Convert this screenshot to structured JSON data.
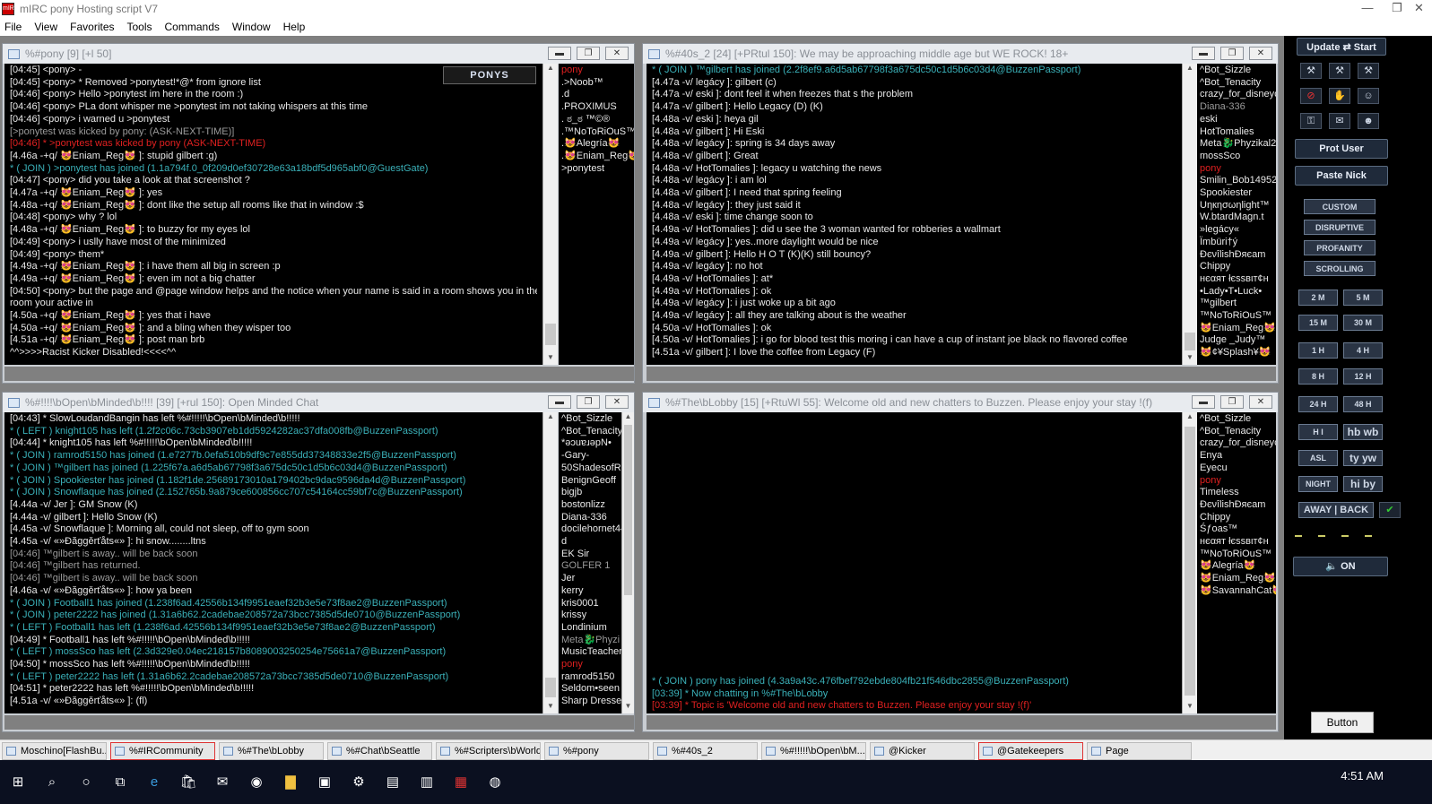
{
  "app": {
    "title": "mIRC pony Hosting script V7"
  },
  "window_controls": {
    "minimize": "—",
    "maximize": "❐",
    "close": "✕"
  },
  "menu": [
    "File",
    "View",
    "Favorites",
    "Tools",
    "Commands",
    "Window",
    "Help"
  ],
  "pony_window": {
    "title": "%#pony [9] [+l 50]",
    "ponys_button": "PONYS",
    "lines": [
      {
        "t": "[04:45] <pony> -",
        "c": ""
      },
      {
        "t": "[04:45] <pony> * Removed >ponytest!*@* from ignore list",
        "c": ""
      },
      {
        "t": "[04:46] <pony> Hello >ponytest im here in the room :)",
        "c": ""
      },
      {
        "t": "[04:46] <pony> PLa dont whisper me >ponytest im not taking whispers at this time",
        "c": ""
      },
      {
        "t": "[04:46] <pony> i warned u >ponytest",
        "c": ""
      },
      {
        "t": "[>ponytest was kicked by pony: (ASK-NEXT-TIME)]",
        "c": "c-gray"
      },
      {
        "t": "[04:46] * >ponytest was kicked by pony (ASK-NEXT-TIME)",
        "c": "c-red"
      },
      {
        "t": "[4.46a -+q/ 😻Eniam_Reg😻 ]: stupid gilbert :g)",
        "c": ""
      },
      {
        "t": "* ( JOIN ) >ponytest has joined (1.1a794f.0_0f209d0ef30728e63a18bdf5d965abf0@GuestGate)",
        "c": "c-cyan"
      },
      {
        "t": "[04:47] <pony> did you take a look at that screenshot ?",
        "c": ""
      },
      {
        "t": "[4.47a -+q/ 😻Eniam_Reg😻 ]: yes",
        "c": ""
      },
      {
        "t": "[4.48a -+q/ 😻Eniam_Reg😻 ]: dont like the setup all rooms like that in window :$",
        "c": ""
      },
      {
        "t": "[04:48] <pony> why ? lol",
        "c": ""
      },
      {
        "t": "[4.48a -+q/ 😻Eniam_Reg😻 ]: to buzzy for my eyes lol",
        "c": ""
      },
      {
        "t": "[04:49] <pony> i uslly have most of the minimized",
        "c": ""
      },
      {
        "t": "[04:49] <pony> them*",
        "c": ""
      },
      {
        "t": "[4.49a -+q/ 😻Eniam_Reg😻 ]: i have them all big in screen :p",
        "c": ""
      },
      {
        "t": "[4.49a -+q/ 😻Eniam_Reg😻 ]: even im not a big chatter",
        "c": ""
      },
      {
        "t": "[04:50] <pony> but the page and @page window helps and the notice when your name is said in a room shows you in the",
        "c": ""
      },
      {
        "t": "room your active in",
        "c": ""
      },
      {
        "t": "[4.50a -+q/ 😻Eniam_Reg😻 ]: yes that i have",
        "c": ""
      },
      {
        "t": "[4.50a -+q/ 😻Eniam_Reg😻 ]: and a bling when they wisper too",
        "c": ""
      },
      {
        "t": "[4.51a -+q/ 😻Eniam_Reg😻 ]: post man brb",
        "c": ""
      },
      {
        "t": "^^>>>>Racist Kicker Disabled!<<<<^^",
        "c": ""
      }
    ],
    "nicks": [
      {
        "n": "pony",
        "c": "c-red"
      },
      {
        "n": ".>Noob™",
        "c": ""
      },
      {
        "n": ".d",
        "c": ""
      },
      {
        "n": ".PROXIMUS",
        "c": ""
      },
      {
        "n": ". ಠ_ಠ ™©®",
        "c": ""
      },
      {
        "n": ".™NoToRiOuS™",
        "c": ""
      },
      {
        "n": ".😻Alegría😻",
        "c": ""
      },
      {
        "n": ".😻Eniam_Reg😻",
        "c": ""
      },
      {
        "n": ">ponytest",
        "c": ""
      }
    ]
  },
  "w40s_window": {
    "title": "%#40s_2 [24] [+PRtul 150]: We may be approaching middle age but WE ROCK! 18+",
    "lines": [
      {
        "t": "* ( JOIN ) ™gilbert has joined (2.2f8ef9.a6d5ab67798f3a675dc50c1d5b6c03d4@BuzzenPassport)",
        "c": "c-cyan"
      },
      {
        "t": "[4.47a -v/ legácy ]: gilbert (c)",
        "c": ""
      },
      {
        "t": "[4.47a -v/ eski ]: dont feel it when freezes that s the problem",
        "c": ""
      },
      {
        "t": "[4.47a -v/ gilbert ]: Hello Legacy (D) (K)",
        "c": ""
      },
      {
        "t": "[4.48a -v/ eski ]: heya gil",
        "c": ""
      },
      {
        "t": "[4.48a -v/ gilbert ]: Hi Eski",
        "c": ""
      },
      {
        "t": "[4.48a -v/ legácy ]: spring is 34 days away",
        "c": ""
      },
      {
        "t": "[4.48a -v/ gilbert ]: Great",
        "c": ""
      },
      {
        "t": "[4.48a -v/ HotTomalies ]: legacy u watching the news",
        "c": ""
      },
      {
        "t": "[4.48a -v/ legácy ]: i am lol",
        "c": ""
      },
      {
        "t": "[4.48a -v/ gilbert ]: I need that spring feeling",
        "c": ""
      },
      {
        "t": "[4.48a -v/ legácy ]: they just said it",
        "c": ""
      },
      {
        "t": "[4.48a -v/ eski ]: time change soon to",
        "c": ""
      },
      {
        "t": "[4.49a -v/ HotTomalies ]: did u see the 3 woman wanted for robberies a wallmart",
        "c": ""
      },
      {
        "t": "[4.49a -v/ legácy ]: yes..more daylight would be nice",
        "c": ""
      },
      {
        "t": "[4.49a -v/ gilbert ]: Hello H O T (K)(K) still bouncy?",
        "c": ""
      },
      {
        "t": "[4.49a -v/ legácy ]: no hot",
        "c": ""
      },
      {
        "t": "[4.49a -v/ HotTomalies ]: at*",
        "c": ""
      },
      {
        "t": "[4.49a -v/ HotTomalies ]: ok",
        "c": ""
      },
      {
        "t": "[4.49a -v/ legácy ]: i just woke up a bit ago",
        "c": ""
      },
      {
        "t": "[4.49a -v/ legácy ]: all they are talking about is the weather",
        "c": ""
      },
      {
        "t": "[4.50a -v/ HotTomalies ]: ok",
        "c": ""
      },
      {
        "t": "[4.50a -v/ HotTomalies ]: i go for blood test this moring i can have a cup of instant joe black no flavored coffee",
        "c": ""
      },
      {
        "t": "[4.51a -v/ gilbert ]: I love the coffee from Legacy (F)",
        "c": ""
      }
    ],
    "nicks": [
      {
        "n": "^Bot_Sizzle",
        "c": ""
      },
      {
        "n": "^Bot_Tenacity",
        "c": ""
      },
      {
        "n": "crazy_for_disneyc",
        "c": ""
      },
      {
        "n": "Diana-336",
        "c": "c-gray"
      },
      {
        "n": "eski",
        "c": ""
      },
      {
        "n": "HotTomalies",
        "c": ""
      },
      {
        "n": "Meta🐉Phyzikal2",
        "c": ""
      },
      {
        "n": "mossSco",
        "c": ""
      },
      {
        "n": "pony",
        "c": "c-red"
      },
      {
        "n": "Smilin_Bob14952",
        "c": ""
      },
      {
        "n": "Spookiester",
        "c": ""
      },
      {
        "n": "Uηкησωηlight™",
        "c": ""
      },
      {
        "n": "W.btardMagn.t",
        "c": ""
      },
      {
        "n": "»legácy«",
        "c": ""
      },
      {
        "n": "Ïmbüri†ý",
        "c": ""
      },
      {
        "n": "ĐєνîlishĐяєam",
        "c": ""
      },
      {
        "n": "Chippy",
        "c": ""
      },
      {
        "n": "нєαят łєssвιт¢н",
        "c": ""
      },
      {
        "n": "•Lady•T•Luck•",
        "c": ""
      },
      {
        "n": "™gilbert",
        "c": ""
      },
      {
        "n": "™NoToRiOuS™",
        "c": ""
      },
      {
        "n": "😻Eniam_Reg😻",
        "c": ""
      },
      {
        "n": "Judge _Judy™",
        "c": ""
      },
      {
        "n": "😻¢¥Splash¥😻",
        "c": ""
      }
    ]
  },
  "openminded_window": {
    "title": "%#!!!!\\bOpen\\bMinded\\b!!!! [39] [+rul 150]: Open Minded Chat",
    "lines": [
      {
        "t": "[04:43] * SlowLoudandBangin has left %#!!!!!\\bOpen\\bMinded\\b!!!!!",
        "c": ""
      },
      {
        "t": "* ( LEFT ) knight105 has left (1.2f2c06c.73cb3907eb1dd5924282ac37dfa008fb@BuzzenPassport)",
        "c": "c-cyan"
      },
      {
        "t": "[04:44] * knight105 has left %#!!!!!\\bOpen\\bMinded\\b!!!!!",
        "c": ""
      },
      {
        "t": "* ( JOIN ) ramrod5150 has joined (1.e7277b.0efa510b9df9c7e855dd37348833e2f5@BuzzenPassport)",
        "c": "c-cyan"
      },
      {
        "t": "* ( JOIN ) ™gilbert has joined (1.225f67a.a6d5ab67798f3a675dc50c1d5b6c03d4@BuzzenPassport)",
        "c": "c-cyan"
      },
      {
        "t": "* ( JOIN ) Spookiester has joined (1.182f1de.25689173010a179402bc9dac9596da4d@BuzzenPassport)",
        "c": "c-cyan"
      },
      {
        "t": "* ( JOIN ) Snowflaque has joined (2.152765b.9a879ce600856cc707c54164cc59bf7c@BuzzenPassport)",
        "c": "c-cyan"
      },
      {
        "t": "[4.44a -v/ Jer ]: GM Snow (K)",
        "c": ""
      },
      {
        "t": "[4.44a -v/ gilbert ]: Hello Snow (K)",
        "c": ""
      },
      {
        "t": "[4.45a -v/ Snowflaque ]: Morning all, could not sleep, off to gym soon",
        "c": ""
      },
      {
        "t": "[4.45a -v/ «»Đăggěrťåts«» ]: hi snow........ltns",
        "c": ""
      },
      {
        "t": "[04:46] ™gilbert is away.. will be back soon",
        "c": "c-gray"
      },
      {
        "t": "[04:46] ™gilbert has returned.",
        "c": "c-gray"
      },
      {
        "t": "[04:46] ™gilbert is away.. will be back soon",
        "c": "c-gray"
      },
      {
        "t": "[4.46a -v/ «»Đăggěrťåts«» ]: how ya been",
        "c": ""
      },
      {
        "t": "* ( JOIN ) Football1 has joined (1.238f6ad.42556b134f9951eaef32b3e5e73f8ae2@BuzzenPassport)",
        "c": "c-cyan"
      },
      {
        "t": "* ( JOIN ) peter2222 has joined (1.31a6b62.2cadebae208572a73bcc7385d5de0710@BuzzenPassport)",
        "c": "c-cyan"
      },
      {
        "t": "* ( LEFT ) Football1 has left (1.238f6ad.42556b134f9951eaef32b3e5e73f8ae2@BuzzenPassport)",
        "c": "c-cyan"
      },
      {
        "t": "[04:49] * Football1 has left %#!!!!!\\bOpen\\bMinded\\b!!!!!",
        "c": ""
      },
      {
        "t": "* ( LEFT ) mossSco has left (2.3d329e0.04ec218157b8089003250254e75661a7@BuzzenPassport)",
        "c": "c-cyan"
      },
      {
        "t": "[04:50] * mossSco has left %#!!!!!\\bOpen\\bMinded\\b!!!!!",
        "c": ""
      },
      {
        "t": "* ( LEFT ) peter2222 has left (1.31a6b62.2cadebae208572a73bcc7385d5de0710@BuzzenPassport)",
        "c": "c-cyan"
      },
      {
        "t": "[04:51] * peter2222 has left %#!!!!!\\bOpen\\bMinded\\b!!!!!",
        "c": ""
      },
      {
        "t": "[4.51a -v/ «»Đăggěrťåts«» ]: (fl)",
        "c": ""
      }
    ],
    "nicks": [
      {
        "n": "^Bot_Sizzle",
        "c": ""
      },
      {
        "n": "^Bot_Tenacity",
        "c": ""
      },
      {
        "n": "*ǝɔuɐɹǝpN•",
        "c": ""
      },
      {
        "n": "-Gary-",
        "c": ""
      },
      {
        "n": "50ShadesofRe",
        "c": ""
      },
      {
        "n": "BenignGeoff",
        "c": ""
      },
      {
        "n": "bigjb",
        "c": ""
      },
      {
        "n": "bostonlizz",
        "c": ""
      },
      {
        "n": "Diana-336",
        "c": ""
      },
      {
        "n": "docilehornet44",
        "c": ""
      },
      {
        "n": "d",
        "c": ""
      },
      {
        "n": "EK Sir",
        "c": ""
      },
      {
        "n": "GOLFER 1",
        "c": "c-gray"
      },
      {
        "n": "Jer",
        "c": ""
      },
      {
        "n": "kerry",
        "c": ""
      },
      {
        "n": "kris0001",
        "c": ""
      },
      {
        "n": "krissy",
        "c": ""
      },
      {
        "n": "Londinium",
        "c": ""
      },
      {
        "n": "Meta🐉Phyzi",
        "c": "c-gray"
      },
      {
        "n": "MusicTeacher",
        "c": ""
      },
      {
        "n": "pony",
        "c": "c-red"
      },
      {
        "n": "ramrod5150",
        "c": ""
      },
      {
        "n": "Seldom•seen",
        "c": ""
      },
      {
        "n": "Sharp Dressed",
        "c": ""
      }
    ]
  },
  "lobby_window": {
    "title": "%#The\\bLobby [15] [+RtuWl 55]: Welcome old and new chatters to Buzzen. Please enjoy your stay !(f)",
    "lines": [
      {
        "t": "* ( JOIN ) pony has joined (4.3a9a43c.476fbef792ebde804fb21f546dbc2855@BuzzenPassport)",
        "c": "c-cyan"
      },
      {
        "t": "[03:39] * Now chatting in %#The\\bLobby",
        "c": "c-cyan"
      },
      {
        "t": "[03:39] * Topic is 'Welcome old and new chatters to Buzzen. Please enjoy your stay !(f)'",
        "c": "c-red"
      }
    ],
    "nicks": [
      {
        "n": "^Bot_Sizzle",
        "c": ""
      },
      {
        "n": "^Bot_Tenacity",
        "c": ""
      },
      {
        "n": "crazy_for_disneyc",
        "c": ""
      },
      {
        "n": "Enya",
        "c": ""
      },
      {
        "n": "Eyecu",
        "c": ""
      },
      {
        "n": "pony",
        "c": "c-red"
      },
      {
        "n": "Timeless",
        "c": ""
      },
      {
        "n": "ĐєνîlishĐяєam",
        "c": ""
      },
      {
        "n": "Chippy",
        "c": ""
      },
      {
        "n": "Śƒoas™",
        "c": ""
      },
      {
        "n": "нєαят łєssвιт¢н",
        "c": ""
      },
      {
        "n": "™NoToRiOuS™",
        "c": ""
      },
      {
        "n": "😻Alegría😻",
        "c": ""
      },
      {
        "n": "😻Eniam_Reg😻",
        "c": ""
      },
      {
        "n": "😻SavannahCat😻",
        "c": ""
      }
    ]
  },
  "sidebar": {
    "update_start": "Update ⇄ Start",
    "prot_user": "Prot User",
    "paste_nick": "Paste Nick",
    "kickers": [
      "CUSTOM",
      "DISRUPTIVE",
      "PROFANITY",
      "SCROLLING"
    ],
    "times": [
      "2 M",
      "5 M",
      "15 M",
      "30 M",
      "1 H",
      "4 H",
      "8 H",
      "12 H",
      "24 H",
      "48 H"
    ],
    "greets": [
      "H I",
      "hb wb",
      "ASL",
      "ty yw",
      "NIGHT",
      "hi by"
    ],
    "away_back": "AWAY | BACK",
    "sound": "ON",
    "button": "Button"
  },
  "mirc_tasks": [
    {
      "label": "Moschino[FlashBu...",
      "active": false
    },
    {
      "label": "%#IRCommunity",
      "active": true
    },
    {
      "label": "%#The\\bLobby",
      "active": false
    },
    {
      "label": "%#Chat\\bSeattle",
      "active": false
    },
    {
      "label": "%#Scripters\\bWorld",
      "active": false
    },
    {
      "label": "%#pony",
      "active": false
    },
    {
      "label": "%#40s_2",
      "active": false
    },
    {
      "label": "%#!!!!!\\bOpen\\bM...",
      "active": false
    },
    {
      "label": "@Kicker",
      "active": false
    },
    {
      "label": "@Gatekeepers",
      "active": true
    },
    {
      "label": "Page",
      "active": false
    }
  ],
  "clock": "4:51 AM"
}
